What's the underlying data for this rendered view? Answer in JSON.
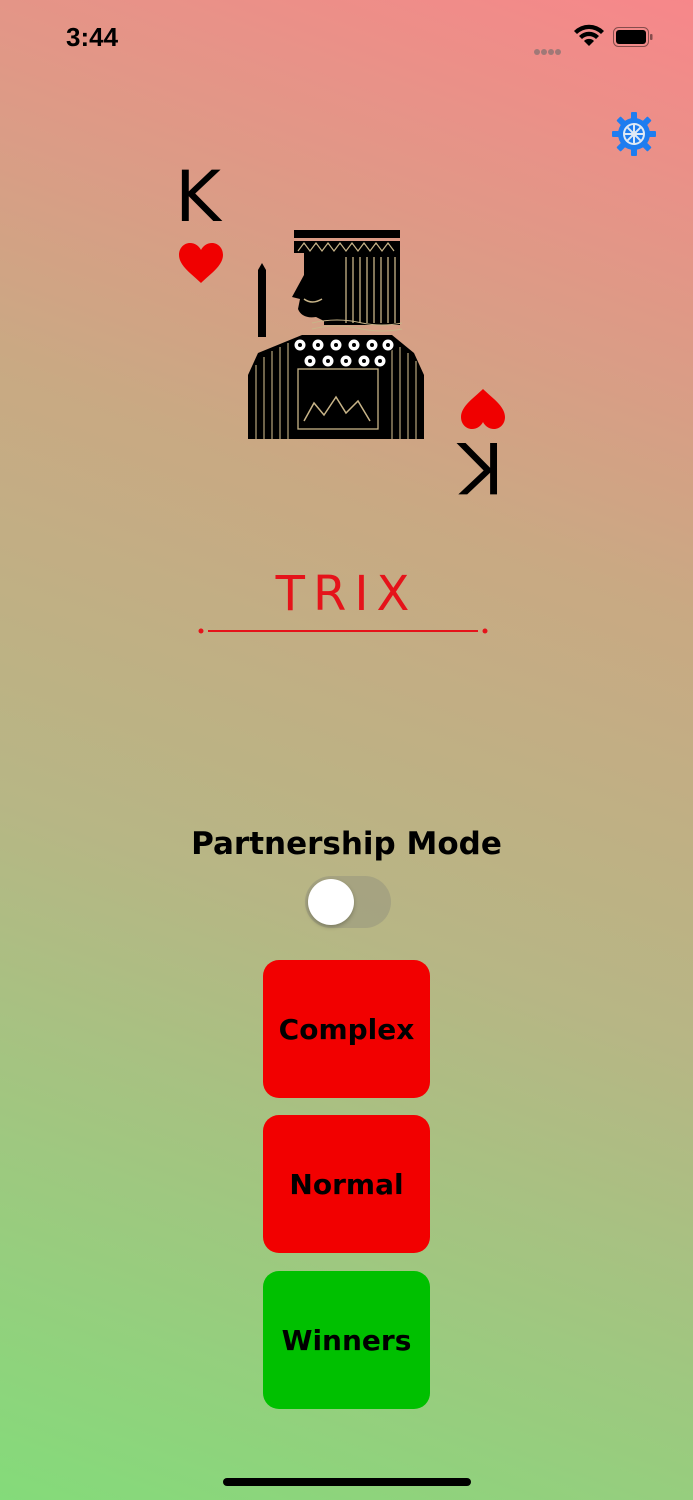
{
  "status_bar": {
    "time": "3:44"
  },
  "card": {
    "rank": "K",
    "suit": "hearts"
  },
  "app": {
    "title": "TRIX"
  },
  "partnership": {
    "label": "Partnership Mode",
    "enabled": false
  },
  "buttons": {
    "complex": "Complex",
    "normal": "Normal",
    "winners": "Winners"
  },
  "icons": {
    "settings": "gear-icon",
    "wifi": "wifi-icon",
    "battery": "battery-icon"
  },
  "colors": {
    "accent_red": "#f20000",
    "accent_green": "#00c000",
    "settings_blue": "#1e7df0",
    "title_red": "#e5131a"
  }
}
